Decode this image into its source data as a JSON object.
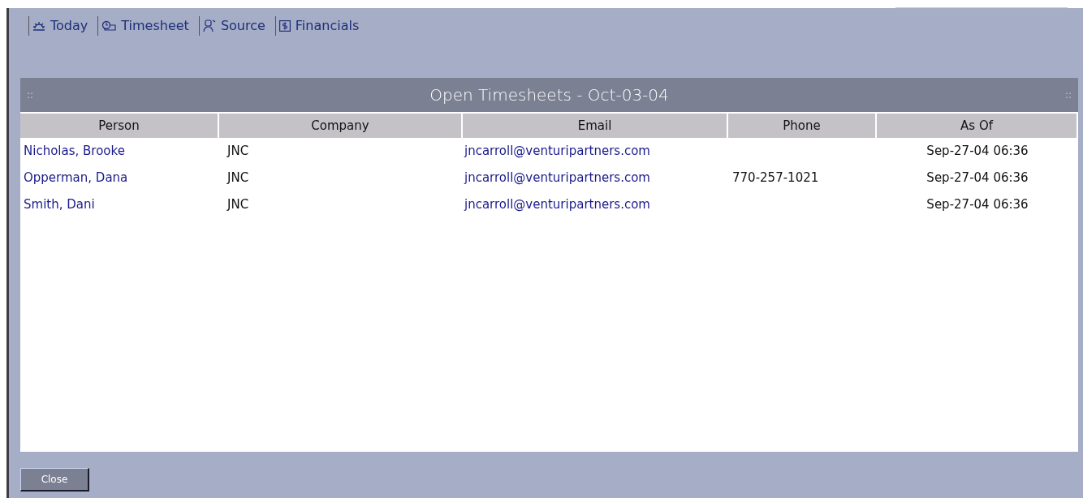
{
  "nav": [
    {
      "label": "Today"
    },
    {
      "label": "Timesheet"
    },
    {
      "label": "Source"
    },
    {
      "label": "Financials"
    }
  ],
  "panel": {
    "title": "Open Timesheets - Oct-03-04",
    "grip_left": "::",
    "grip_right": "::"
  },
  "table": {
    "columns": [
      "Person",
      "Company",
      "Email",
      "Phone",
      "As Of"
    ],
    "rows": [
      [
        "Nicholas, Brooke",
        "JNC",
        "jncarroll@venturipartners.com",
        "",
        "Sep-27-04 06:36"
      ],
      [
        "Opperman, Dana",
        "JNC",
        "jncarroll@venturipartners.com",
        "770-257-1021",
        "Sep-27-04 06:36"
      ],
      [
        "Smith, Dani",
        "JNC",
        "jncarroll@venturipartners.com",
        "",
        "Sep-27-04 06:36"
      ]
    ]
  },
  "buttons": [
    "Close"
  ]
}
